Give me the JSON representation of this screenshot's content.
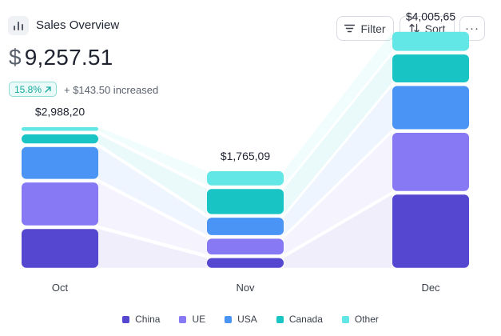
{
  "header": {
    "title": "Sales Overview",
    "filter_label": "Filter",
    "sort_label": "Sort",
    "more_label": "···"
  },
  "summary": {
    "currency": "$",
    "total": "9,257.51",
    "change_percent": "15.8%",
    "change_text": "+ $143.50 increased"
  },
  "colors": {
    "China": "#5547cf",
    "UE": "#8679f3",
    "USA": "#4a94f5",
    "Canada": "#19c4c4",
    "Other": "#62e6e6"
  },
  "icons": [
    "bar-chart-icon",
    "filter-icon",
    "sort-icon",
    "more-icon",
    "arrow-up-right-icon"
  ],
  "chart_data": {
    "type": "bar",
    "stacked": true,
    "categories": [
      "Oct",
      "Nov",
      "Dec"
    ],
    "totals_labels": [
      "$2,988,20",
      "$1,765,09",
      "$4,005,65"
    ],
    "series": [
      {
        "name": "China",
        "values": [
          1050,
          330,
          1900
        ]
      },
      {
        "name": "UE",
        "values": [
          1150,
          480,
          1530
        ]
      },
      {
        "name": "USA",
        "values": [
          880,
          520,
          1160
        ]
      },
      {
        "name": "Canada",
        "values": [
          310,
          710,
          780
        ]
      },
      {
        "name": "Other",
        "values": [
          180,
          440,
          560
        ]
      }
    ],
    "legend_position": "bottom",
    "grid": false
  }
}
